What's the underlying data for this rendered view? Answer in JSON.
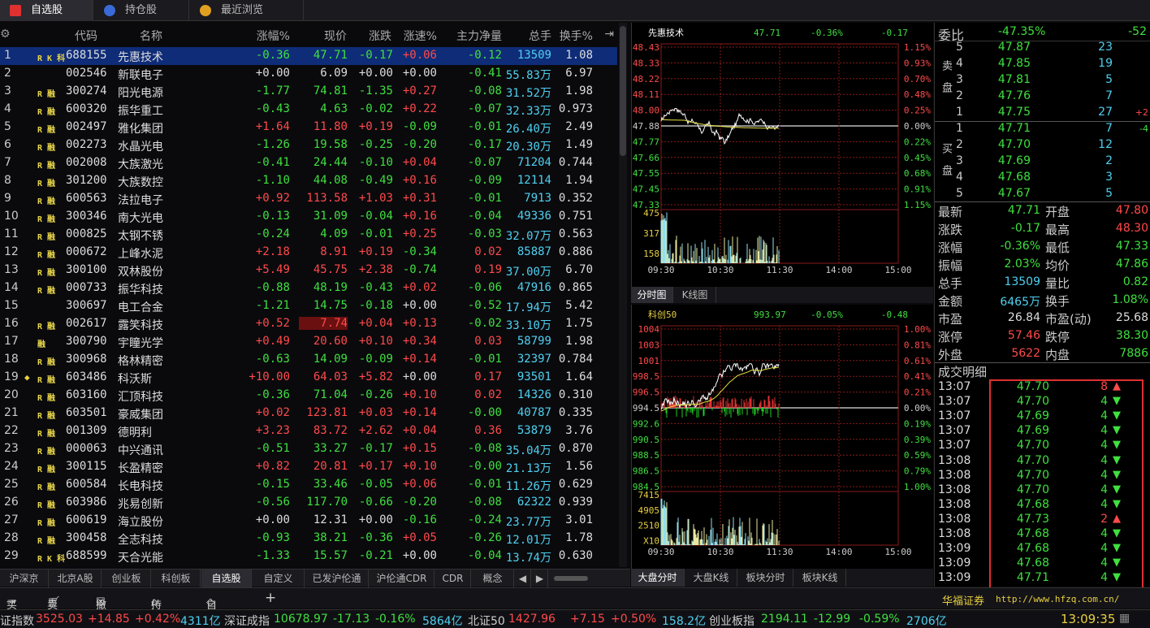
{
  "top_tabs": [
    "自选股",
    "持仓股",
    "最近浏览"
  ],
  "header": {
    "code": "代码",
    "name": "名称",
    "chg": "涨幅%",
    "price": "现价",
    "updown": "涨跌",
    "speed": "涨速%",
    "mainflow": "主力净量",
    "vol": "总手",
    "turnover": "换手%"
  },
  "rows": [
    {
      "no": "1",
      "flag": "R K 科",
      "code": "688155",
      "name": "先惠技术",
      "chg": "-0.36",
      "price": "47.71",
      "ud": "-0.17",
      "sp": "+0.06",
      "mf": "-0.12",
      "vol": "13509",
      "to": "1.08"
    },
    {
      "no": "2",
      "flag": "",
      "code": "002546",
      "name": "新联电子",
      "chg": "+0.00",
      "price": "6.09",
      "ud": "+0.00",
      "sp": "+0.00",
      "mf": "-0.41",
      "vol": "55.83万",
      "to": "6.97"
    },
    {
      "no": "3",
      "flag": "R 融",
      "code": "300274",
      "name": "阳光电源",
      "chg": "-1.77",
      "price": "74.81",
      "ud": "-1.35",
      "sp": "+0.27",
      "mf": "-0.08",
      "vol": "31.52万",
      "to": "1.98"
    },
    {
      "no": "4",
      "flag": "R 融",
      "code": "600320",
      "name": "振华重工",
      "chg": "-0.43",
      "price": "4.63",
      "ud": "-0.02",
      "sp": "+0.22",
      "mf": "-0.07",
      "vol": "32.33万",
      "to": "0.973"
    },
    {
      "no": "5",
      "flag": "R 融",
      "code": "002497",
      "name": "雅化集团",
      "chg": "+1.64",
      "price": "11.80",
      "ud": "+0.19",
      "sp": "-0.09",
      "mf": "-0.01",
      "vol": "26.40万",
      "to": "2.49"
    },
    {
      "no": "6",
      "flag": "R 融",
      "code": "002273",
      "name": "水晶光电",
      "chg": "-1.26",
      "price": "19.58",
      "ud": "-0.25",
      "sp": "-0.20",
      "mf": "-0.17",
      "vol": "20.30万",
      "to": "1.49"
    },
    {
      "no": "7",
      "flag": "R 融",
      "code": "002008",
      "name": "大族激光",
      "chg": "-0.41",
      "price": "24.44",
      "ud": "-0.10",
      "sp": "+0.04",
      "mf": "-0.07",
      "vol": "71204",
      "to": "0.744"
    },
    {
      "no": "8",
      "flag": "R 融",
      "code": "301200",
      "name": "大族数控",
      "chg": "-1.10",
      "price": "44.08",
      "ud": "-0.49",
      "sp": "+0.16",
      "mf": "-0.09",
      "vol": "12114",
      "to": "1.94"
    },
    {
      "no": "9",
      "flag": "R 融",
      "code": "600563",
      "name": "法拉电子",
      "chg": "+0.92",
      "price": "113.58",
      "ud": "+1.03",
      "sp": "+0.31",
      "mf": "-0.01",
      "vol": "7913",
      "to": "0.352"
    },
    {
      "no": "10",
      "flag": "R 融",
      "code": "300346",
      "name": "南大光电",
      "chg": "-0.13",
      "price": "31.09",
      "ud": "-0.04",
      "sp": "+0.16",
      "mf": "-0.04",
      "vol": "49336",
      "to": "0.751"
    },
    {
      "no": "11",
      "flag": "R 融",
      "code": "000825",
      "name": "太钢不锈",
      "chg": "-0.24",
      "price": "4.09",
      "ud": "-0.01",
      "sp": "+0.25",
      "mf": "-0.03",
      "vol": "32.07万",
      "to": "0.563"
    },
    {
      "no": "12",
      "flag": "R 融",
      "code": "000672",
      "name": "上峰水泥",
      "chg": "+2.18",
      "price": "8.91",
      "ud": "+0.19",
      "sp": "-0.34",
      "mf": "0.02",
      "vol": "85887",
      "to": "0.886"
    },
    {
      "no": "13",
      "flag": "R 融",
      "code": "300100",
      "name": "双林股份",
      "chg": "+5.49",
      "price": "45.75",
      "ud": "+2.38",
      "sp": "-0.74",
      "mf": "0.19",
      "vol": "37.00万",
      "to": "6.70"
    },
    {
      "no": "14",
      "flag": "R 融",
      "code": "000733",
      "name": "振华科技",
      "chg": "-0.88",
      "price": "48.19",
      "ud": "-0.43",
      "sp": "+0.02",
      "mf": "-0.06",
      "vol": "47916",
      "to": "0.865"
    },
    {
      "no": "15",
      "flag": "",
      "code": "300697",
      "name": "电工合金",
      "chg": "-1.21",
      "price": "14.75",
      "ud": "-0.18",
      "sp": "+0.00",
      "mf": "-0.52",
      "vol": "17.94万",
      "to": "5.42"
    },
    {
      "no": "16",
      "flag": "R 融",
      "code": "002617",
      "name": "露笑科技",
      "chg": "+0.52",
      "price": "7.74",
      "ud": "+0.04",
      "sp": "+0.13",
      "mf": "-0.02",
      "vol": "33.10万",
      "to": "1.75"
    },
    {
      "no": "17",
      "flag": "融",
      "code": "300790",
      "name": "宇瞳光学",
      "chg": "+0.49",
      "price": "20.60",
      "ud": "+0.10",
      "sp": "+0.34",
      "mf": "0.03",
      "vol": "58799",
      "to": "1.98"
    },
    {
      "no": "18",
      "flag": "R 融",
      "code": "300968",
      "name": "格林精密",
      "chg": "-0.63",
      "price": "14.09",
      "ud": "-0.09",
      "sp": "+0.14",
      "mf": "-0.01",
      "vol": "32397",
      "to": "0.784"
    },
    {
      "no": "19",
      "flag": "R 融",
      "code": "603486",
      "name": "科沃斯",
      "chg": "+10.00",
      "price": "64.03",
      "ud": "+5.82",
      "sp": "+0.00",
      "mf": "0.17",
      "vol": "93501",
      "to": "1.64"
    },
    {
      "no": "20",
      "flag": "R 融",
      "code": "603160",
      "name": "汇顶科技",
      "chg": "-0.36",
      "price": "71.04",
      "ud": "-0.26",
      "sp": "+0.10",
      "mf": "0.02",
      "vol": "14326",
      "to": "0.310"
    },
    {
      "no": "21",
      "flag": "R 融",
      "code": "603501",
      "name": "豪威集团",
      "chg": "+0.02",
      "price": "123.81",
      "ud": "+0.03",
      "sp": "+0.14",
      "mf": "-0.00",
      "vol": "40787",
      "to": "0.335"
    },
    {
      "no": "22",
      "flag": "R 融",
      "code": "001309",
      "name": "德明利",
      "chg": "+3.23",
      "price": "83.72",
      "ud": "+2.62",
      "sp": "+0.04",
      "mf": "0.36",
      "vol": "53879",
      "to": "3.76"
    },
    {
      "no": "23",
      "flag": "R 融",
      "code": "000063",
      "name": "中兴通讯",
      "chg": "-0.51",
      "price": "33.27",
      "ud": "-0.17",
      "sp": "+0.15",
      "mf": "-0.08",
      "vol": "35.04万",
      "to": "0.870"
    },
    {
      "no": "24",
      "flag": "R 融",
      "code": "300115",
      "name": "长盈精密",
      "chg": "+0.82",
      "price": "20.81",
      "ud": "+0.17",
      "sp": "+0.10",
      "mf": "-0.00",
      "vol": "21.13万",
      "to": "1.56"
    },
    {
      "no": "25",
      "flag": "R 融",
      "code": "600584",
      "name": "长电科技",
      "chg": "-0.15",
      "price": "33.46",
      "ud": "-0.05",
      "sp": "+0.06",
      "mf": "-0.01",
      "vol": "11.26万",
      "to": "0.629"
    },
    {
      "no": "26",
      "flag": "R 融",
      "code": "603986",
      "name": "兆易创新",
      "chg": "-0.56",
      "price": "117.70",
      "ud": "-0.66",
      "sp": "-0.20",
      "mf": "-0.08",
      "vol": "62322",
      "to": "0.939"
    },
    {
      "no": "27",
      "flag": "R 融",
      "code": "600619",
      "name": "海立股份",
      "chg": "+0.00",
      "price": "12.31",
      "ud": "+0.00",
      "sp": "-0.16",
      "mf": "-0.24",
      "vol": "23.77万",
      "to": "3.01"
    },
    {
      "no": "28",
      "flag": "R 融",
      "code": "300458",
      "name": "全志科技",
      "chg": "-0.93",
      "price": "38.21",
      "ud": "-0.36",
      "sp": "+0.05",
      "mf": "-0.26",
      "vol": "12.01万",
      "to": "1.78"
    },
    {
      "no": "29",
      "flag": "R K 科",
      "code": "688599",
      "name": "天合光能",
      "chg": "-1.33",
      "price": "15.57",
      "ud": "-0.21",
      "sp": "+0.00",
      "mf": "-0.04",
      "vol": "13.74万",
      "to": "0.630"
    }
  ],
  "bottom_tabs": [
    "沪深京",
    "北京A股",
    "创业板",
    "科创板",
    "自选股",
    "自定义",
    "已发沪伦通",
    "沪伦通CDR",
    "CDR",
    "概念"
  ],
  "chart1": {
    "name": "先惠技术",
    "price": "47.71",
    "pct": "-0.36%",
    "chg": "-0.17",
    "yl": [
      "48.43",
      "48.33",
      "48.22",
      "48.11",
      "48.00",
      "47.88",
      "47.77",
      "47.66",
      "47.55",
      "47.45",
      "47.33"
    ],
    "yr": [
      "1.15%",
      "0.93%",
      "0.70%",
      "0.48%",
      "0.25%",
      "0.00%",
      "0.22%",
      "0.45%",
      "0.68%",
      "0.91%",
      "1.15%"
    ],
    "vl": [
      "475",
      "317",
      "158"
    ],
    "x": [
      "09:30",
      "10:30",
      "11:30",
      "14:00",
      "15:00"
    ],
    "tabs": [
      "分时图",
      "K线图"
    ]
  },
  "chart2": {
    "name": "科创50",
    "price": "993.97",
    "pct": "-0.05%",
    "chg": "-0.48",
    "yl": [
      "1004",
      "1003",
      "1001",
      "998.5",
      "996.5",
      "994.5",
      "992.6",
      "990.5",
      "988.5",
      "986.5",
      "984.5"
    ],
    "yr": [
      "1.00%",
      "0.81%",
      "0.61%",
      "0.41%",
      "0.21%",
      "0.00%",
      "0.19%",
      "0.39%",
      "0.59%",
      "0.79%",
      "1.00%"
    ],
    "vl": [
      "7415",
      "4905",
      "2510",
      "X10"
    ],
    "x": [
      "09:30",
      "10:30",
      "11:30",
      "14:00",
      "15:00"
    ],
    "tabs": [
      "大盘分时",
      "大盘K线",
      "板块分时",
      "板块K线"
    ]
  },
  "order": {
    "wb_label": "委比",
    "wb": "-47.35%",
    "wc": "-52",
    "sell_label": "卖盘",
    "buy_label": "买盘",
    "sell": [
      {
        "l": "5",
        "p": "47.87",
        "v": "23",
        "x": ""
      },
      {
        "l": "4",
        "p": "47.85",
        "v": "19",
        "x": ""
      },
      {
        "l": "3",
        "p": "47.81",
        "v": "5",
        "x": ""
      },
      {
        "l": "2",
        "p": "47.76",
        "v": "7",
        "x": ""
      },
      {
        "l": "1",
        "p": "47.75",
        "v": "27",
        "x": "+2"
      }
    ],
    "buy": [
      {
        "l": "1",
        "p": "47.71",
        "v": "7",
        "x": "-4"
      },
      {
        "l": "2",
        "p": "47.70",
        "v": "12",
        "x": ""
      },
      {
        "l": "3",
        "p": "47.69",
        "v": "2",
        "x": ""
      },
      {
        "l": "4",
        "p": "47.68",
        "v": "3",
        "x": ""
      },
      {
        "l": "5",
        "p": "47.67",
        "v": "5",
        "x": ""
      }
    ]
  },
  "stats": [
    [
      "最新",
      "47.71",
      "开盘",
      "47.80"
    ],
    [
      "涨跌",
      "-0.17",
      "最高",
      "48.30"
    ],
    [
      "涨幅",
      "-0.36%",
      "最低",
      "47.33"
    ],
    [
      "振幅",
      "2.03%",
      "均价",
      "47.86"
    ],
    [
      "总手",
      "13509",
      "量比",
      "0.82"
    ],
    [
      "金额",
      "6465万",
      "换手",
      "1.08%"
    ],
    [
      "市盈",
      "26.84",
      "市盈(动)",
      "25.68"
    ],
    [
      "涨停",
      "57.46",
      "跌停",
      "38.30"
    ],
    [
      "外盘",
      "5622",
      "内盘",
      "7886"
    ]
  ],
  "ticks_title": "成交明细",
  "ticks": [
    [
      "13:07",
      "47.70",
      "8",
      "u"
    ],
    [
      "13:07",
      "47.70",
      "4",
      "d"
    ],
    [
      "13:07",
      "47.69",
      "4",
      "d"
    ],
    [
      "13:07",
      "47.69",
      "4",
      "d"
    ],
    [
      "13:07",
      "47.70",
      "4",
      "d"
    ],
    [
      "13:08",
      "47.70",
      "4",
      "d"
    ],
    [
      "13:08",
      "47.70",
      "4",
      "d"
    ],
    [
      "13:08",
      "47.70",
      "4",
      "d"
    ],
    [
      "13:08",
      "47.68",
      "4",
      "d"
    ],
    [
      "13:08",
      "47.73",
      "2",
      "u"
    ],
    [
      "13:08",
      "47.68",
      "4",
      "d"
    ],
    [
      "13:09",
      "47.68",
      "4",
      "d"
    ],
    [
      "13:09",
      "47.68",
      "4",
      "d"
    ],
    [
      "13:09",
      "47.71",
      "4",
      "d"
    ]
  ],
  "toolbar": {
    "buy": "买入",
    "sell": "卖出",
    "cancel": "撤单",
    "hold": "持仓",
    "self": "自选",
    "brand": "华福证券",
    "url": "http://www.hfzq.com.cn/"
  },
  "ticker": {
    "i1": "证指数",
    "v1": "3525.03",
    "c1": "+14.85",
    "p1": "+0.42%",
    "a1": "4311亿",
    "i2": "深证成指",
    "v2": "10678.97",
    "c2": "-17.13",
    "p2": "-0.16%",
    "a2": "5864亿",
    "i3": "北证50",
    "v3": "1427.96",
    "c3": "+7.15",
    "p3": "+0.50%",
    "a3": "158.2亿",
    "i4": "创业板指",
    "v4": "2194.11",
    "c4": "-12.99",
    "p4": "-0.59%",
    "a4": "2706亿",
    "time": "13:09:35"
  }
}
